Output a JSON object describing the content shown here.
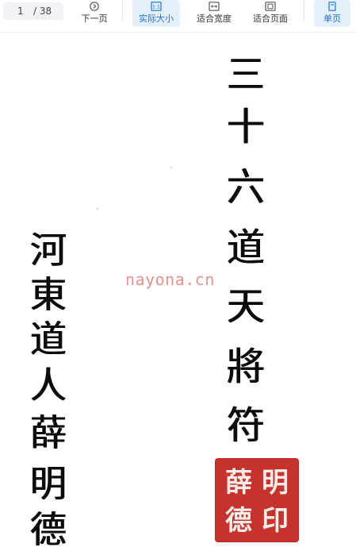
{
  "toolbar": {
    "current_page": "1",
    "total_pages": "/ 38",
    "next_page_label": "下一页",
    "actual_size_label": "实际大小",
    "fit_width_label": "适合宽度",
    "fit_page_label": "适合页面",
    "single_page_label": "单页",
    "active_color": "#1e6fd9"
  },
  "document": {
    "title_chars": [
      "三",
      "十",
      "六",
      "道",
      "天",
      "將",
      "符"
    ],
    "author_chars": [
      "河",
      "東",
      "道",
      "人",
      "薛",
      "明",
      "德"
    ],
    "seal_chars": [
      "薛",
      "明",
      "德",
      "印"
    ],
    "watermark": "nayona.cn",
    "seal_color": "#c6332c"
  }
}
